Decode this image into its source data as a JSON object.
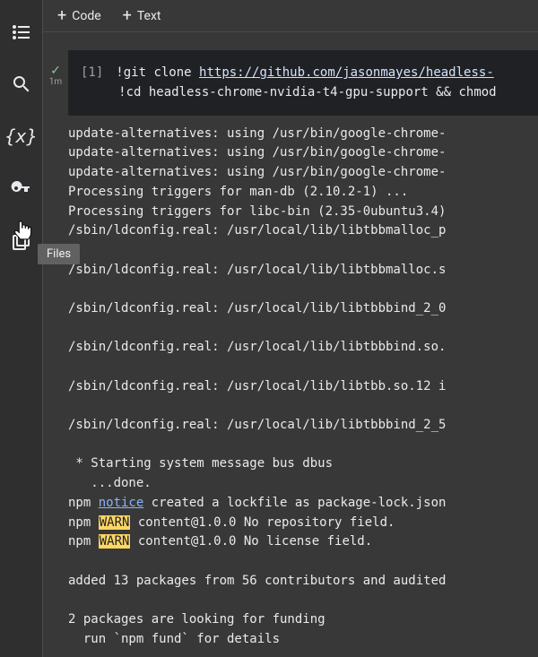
{
  "sidebar": {
    "items": [
      {
        "name": "table-of-contents-icon"
      },
      {
        "name": "search-icon"
      },
      {
        "name": "variables-icon",
        "label": "{x}"
      },
      {
        "name": "secrets-icon"
      },
      {
        "name": "files-icon"
      }
    ],
    "tooltip": "Files"
  },
  "toolbar": {
    "code_label": "Code",
    "text_label": "Text"
  },
  "cell": {
    "status": "✓",
    "elapsed": "1m",
    "prompt": "[1]",
    "cmd_prefix": "!",
    "cmd1_a": "git clone ",
    "cmd1_url": "https://github.com/jasonmayes/headless-",
    "cmd2": "cd headless-chrome-nvidia-t4-gpu-support && chmod"
  },
  "output_lines": [
    "update-alternatives: using /usr/bin/google-chrome-",
    "update-alternatives: using /usr/bin/google-chrome-",
    "update-alternatives: using /usr/bin/google-chrome-",
    "Processing triggers for man-db (2.10.2-1) ...",
    "Processing triggers for libc-bin (2.35-0ubuntu3.4)",
    "/sbin/ldconfig.real: /usr/local/lib/libtbbmalloc_p",
    "",
    "/sbin/ldconfig.real: /usr/local/lib/libtbbmalloc.s",
    "",
    "/sbin/ldconfig.real: /usr/local/lib/libtbbbind_2_0",
    "",
    "/sbin/ldconfig.real: /usr/local/lib/libtbbbind.so.",
    "",
    "/sbin/ldconfig.real: /usr/local/lib/libtbb.so.12 i",
    "",
    "/sbin/ldconfig.real: /usr/local/lib/libtbbbind_2_5",
    "",
    " * Starting system message bus dbus",
    "   ...done."
  ],
  "npm": {
    "notice_word": "notice",
    "notice_rest": " created a lockfile as package-lock.json",
    "warn_word": "WARN",
    "warn1": " content@1.0.0 No repository field.",
    "warn2": " content@1.0.0 No license field."
  },
  "trailer": [
    "",
    "added 13 packages from 56 contributors and audited",
    "",
    "2 packages are looking for funding",
    "  run `npm fund` for details"
  ]
}
